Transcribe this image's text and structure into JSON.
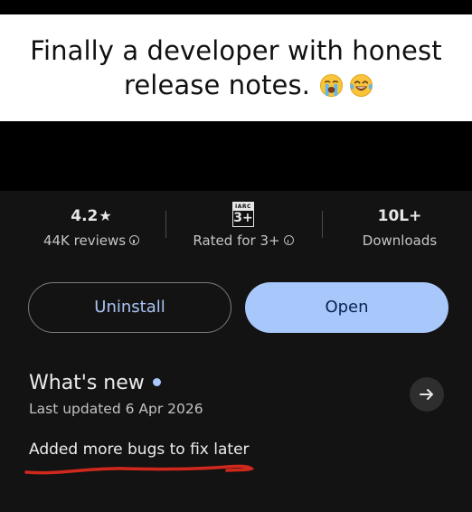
{
  "caption": {
    "line1": "Finally a developer with honest",
    "line2": "release notes.",
    "emojis": [
      "loudly-crying-face-emoji",
      "face-with-tears-of-joy-emoji"
    ]
  },
  "stats": {
    "rating": {
      "value": "4.2",
      "star": "★",
      "label": "44K reviews"
    },
    "age": {
      "badge_top": "IARC",
      "badge_value": "3+",
      "label": "Rated for 3+"
    },
    "downloads": {
      "value": "10L+",
      "label": "Downloads"
    }
  },
  "buttons": {
    "uninstall": "Uninstall",
    "open": "Open"
  },
  "whats_new": {
    "title": "What's new",
    "last_updated": "Last updated 6 Apr 2026",
    "notes": "Added more bugs to fix later"
  },
  "colors": {
    "accent": "#a8c7fa",
    "panel_bg": "#131313",
    "underline": "#d0281c"
  }
}
